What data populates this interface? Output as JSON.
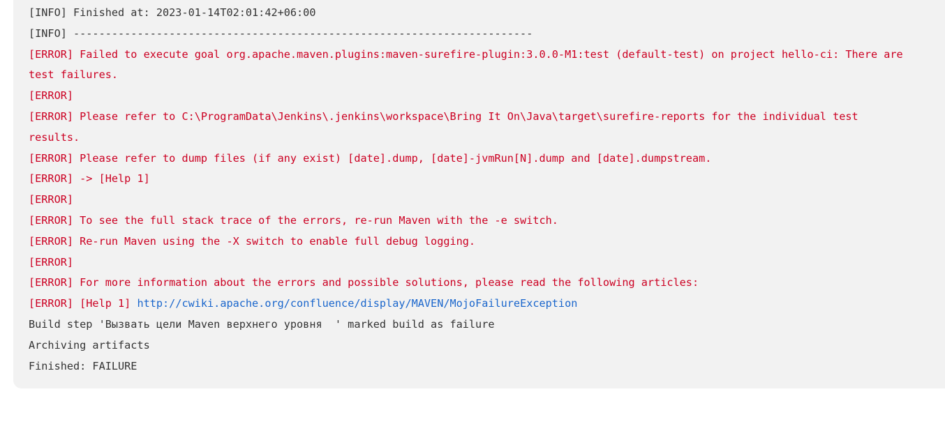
{
  "colors": {
    "panel_bg": "#f2f2f2",
    "text_default": "#333333",
    "text_error": "#cc0022",
    "link": "#1a66cc"
  },
  "console": {
    "lines": [
      {
        "kind": "info",
        "text": "[INFO] Finished at: 2023-01-14T02:01:42+06:00"
      },
      {
        "kind": "info",
        "text": "[INFO] ------------------------------------------------------------------------"
      },
      {
        "kind": "error",
        "text": "[ERROR] Failed to execute goal org.apache.maven.plugins:maven-surefire-plugin:3.0.0-M1:test (default-test) on project hello-ci: There are"
      },
      {
        "kind": "error",
        "text": "test failures."
      },
      {
        "kind": "error",
        "text": "[ERROR]"
      },
      {
        "kind": "error",
        "text": "[ERROR] Please refer to C:\\ProgramData\\Jenkins\\.jenkins\\workspace\\Bring It On\\Java\\target\\surefire-reports for the individual test"
      },
      {
        "kind": "error",
        "text": "results."
      },
      {
        "kind": "error",
        "text": "[ERROR] Please refer to dump files (if any exist) [date].dump, [date]-jvmRun[N].dump and [date].dumpstream."
      },
      {
        "kind": "error",
        "text": "[ERROR] -> [Help 1]"
      },
      {
        "kind": "error",
        "text": "[ERROR]"
      },
      {
        "kind": "error",
        "text": "[ERROR] To see the full stack trace of the errors, re-run Maven with the -e switch."
      },
      {
        "kind": "error",
        "text": "[ERROR] Re-run Maven using the -X switch to enable full debug logging."
      },
      {
        "kind": "error",
        "text": "[ERROR]"
      },
      {
        "kind": "error",
        "text": "[ERROR] For more information about the errors and possible solutions, please read the following articles:"
      },
      {
        "kind": "error",
        "text": "[ERROR] [Help 1] ",
        "link_text": "http://cwiki.apache.org/confluence/display/MAVEN/MojoFailureException"
      },
      {
        "kind": "info",
        "text": "Build step 'Вызвать цели Maven верхнего уровня  ' marked build as failure"
      },
      {
        "kind": "info",
        "text": "Archiving artifacts"
      },
      {
        "kind": "info",
        "text": "Finished: FAILURE"
      }
    ]
  }
}
